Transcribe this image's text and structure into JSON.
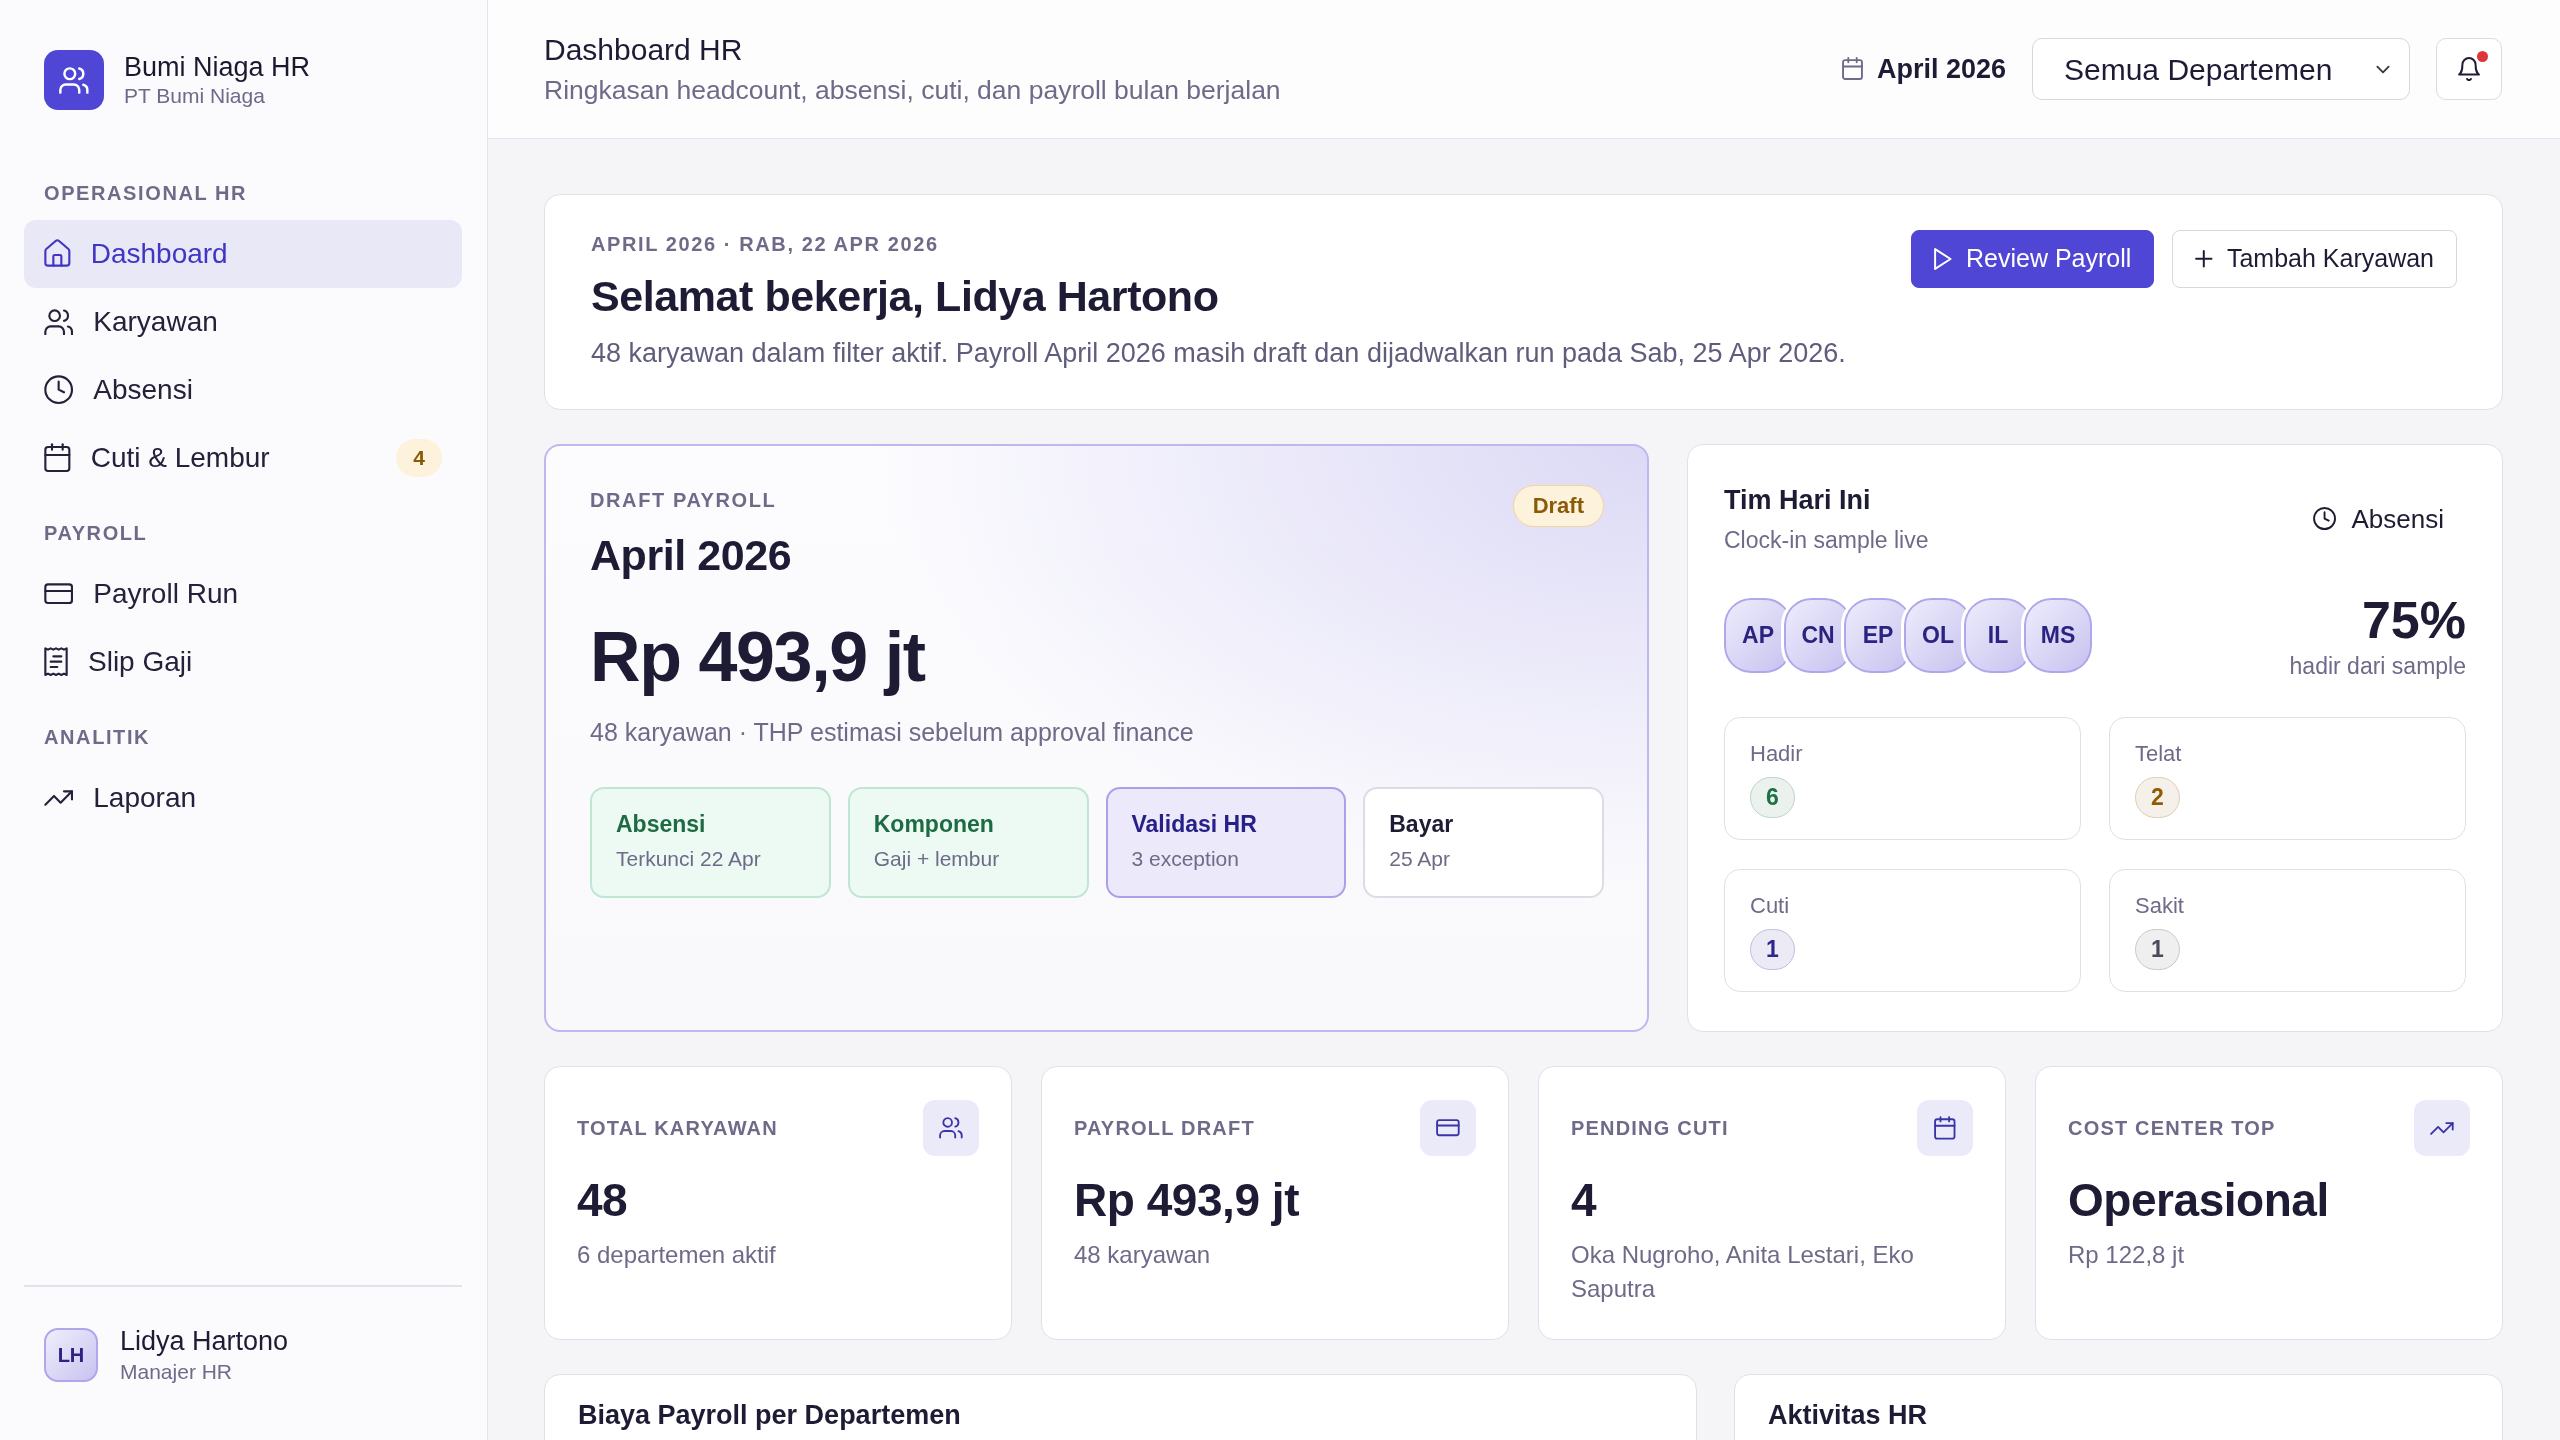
{
  "sidebar": {
    "brand": {
      "name": "Bumi Niaga HR",
      "company": "PT Bumi Niaga"
    },
    "sections": [
      {
        "label": "OPERASIONAL HR",
        "items": [
          {
            "label": "Dashboard",
            "selected": true
          },
          {
            "label": "Karyawan",
            "selected": false
          },
          {
            "label": "Absensi",
            "selected": false
          },
          {
            "label": "Cuti & Lembur",
            "selected": false,
            "badge": "4"
          }
        ]
      },
      {
        "label": "PAYROLL",
        "items": [
          {
            "label": "Payroll Run",
            "selected": false
          },
          {
            "label": "Slip Gaji",
            "selected": false
          }
        ]
      },
      {
        "label": "ANALITIK",
        "items": [
          {
            "label": "Laporan",
            "selected": false
          }
        ]
      }
    ],
    "user": {
      "initials": "LH",
      "name": "Lidya Hartono",
      "role": "Manajer HR"
    }
  },
  "header": {
    "title": "Dashboard HR",
    "subtitle": "Ringkasan headcount, absensi, cuti, dan payroll bulan berjalan",
    "period": "April 2026",
    "department_select": {
      "value": "Semua Departemen"
    },
    "notifications": {
      "unread": true
    }
  },
  "welcome": {
    "eyebrow": "APRIL 2026 · RAB, 22 APR 2026",
    "title": "Selamat bekerja, Lidya Hartono",
    "description": "48 karyawan dalam filter aktif. Payroll April 2026 masih draft dan dijadwalkan run pada Sab, 25 Apr 2026.",
    "buttons": [
      {
        "label": "Review Payroll",
        "kind": "primary"
      },
      {
        "label": "Tambah Karyawan",
        "kind": "outline"
      }
    ]
  },
  "payroll": {
    "eyebrow": "DRAFT PAYROLL",
    "title": "April 2026",
    "status_badge": "Draft",
    "amount": "Rp 493,9 jt",
    "description": "48 karyawan · THP estimasi sebelum approval finance",
    "steps": [
      {
        "title": "Absensi",
        "detail": "Terkunci 22 Apr",
        "done": true,
        "active": false
      },
      {
        "title": "Komponen",
        "detail": "Gaji + lembur",
        "done": true,
        "active": false
      },
      {
        "title": "Validasi HR",
        "detail": "3 exception",
        "done": false,
        "active": true
      },
      {
        "title": "Bayar",
        "detail": "25 Apr",
        "done": false,
        "active": false
      }
    ]
  },
  "team": {
    "title": "Tim Hari Ini",
    "subtitle": "Clock-in sample live",
    "link": "Absensi",
    "avatars": [
      "AP",
      "CN",
      "EP",
      "OL",
      "IL",
      "MS"
    ],
    "rate": "75%",
    "rate_label": "hadir dari sample",
    "stats": [
      {
        "label": "Hadir",
        "count": "6",
        "color": "#1d7147"
      },
      {
        "label": "Telat",
        "count": "2",
        "color": "#8f5c05"
      },
      {
        "label": "Cuti",
        "count": "1",
        "color": "#2c2690"
      },
      {
        "label": "Sakit",
        "count": "1",
        "color": "#4a4a58"
      }
    ]
  },
  "stats": [
    {
      "label": "TOTAL KARYAWAN",
      "value": "48",
      "detail": "6 departemen aktif"
    },
    {
      "label": "PAYROLL DRAFT",
      "value": "Rp 493,9 jt",
      "detail": "48 karyawan"
    },
    {
      "label": "PENDING CUTI",
      "value": "4",
      "detail": "Oka Nugroho, Anita Lestari, Eko Saputra"
    },
    {
      "label": "COST CENTER TOP",
      "value": "Operasional",
      "detail": "Rp 122,8 jt"
    }
  ],
  "panels": [
    {
      "title": "Biaya Payroll per Departemen"
    },
    {
      "title": "Aktivitas HR"
    }
  ]
}
